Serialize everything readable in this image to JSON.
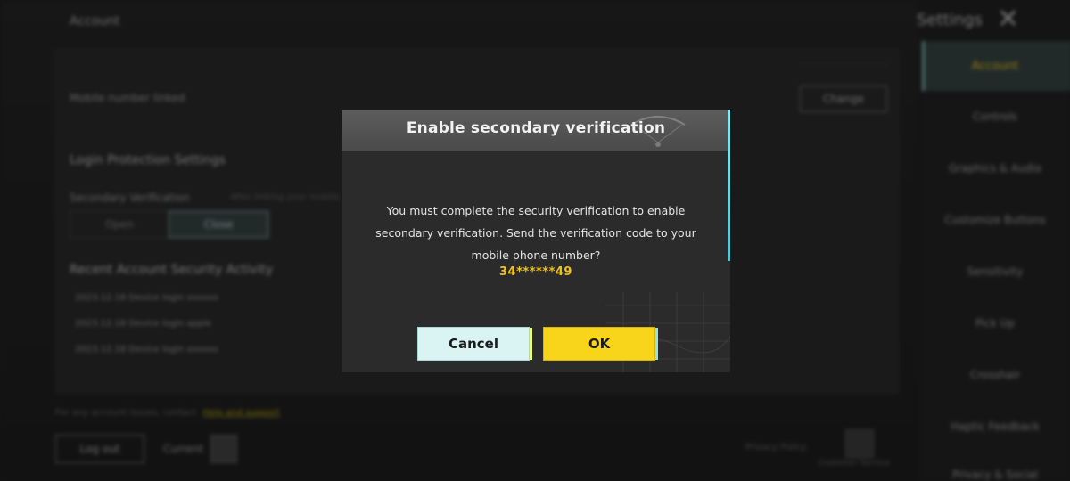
{
  "background": {
    "page_title": "Account",
    "settings_title": "Settings",
    "close_icon": "close-icon",
    "mobile_label": "Mobile number linked",
    "change_label": "Change",
    "login_protection_heading": "Login Protection Settings",
    "secondary_verification_label": "Secondary Verification",
    "secondary_verification_hint": "After linking your mobile...",
    "toggle_options": [
      "Open",
      "Close"
    ],
    "recent_activity_heading": "Recent Account Security Activity",
    "activity_rows": [
      "2023.12.18   Device login   xxxxxx",
      "2023.12.18   Device login   apple",
      "2023.12.18   Device login   xxxxxx"
    ],
    "footer_hint_prefix": "For any account issues, contact",
    "footer_hint_link": "Help and support",
    "log_out_label": "Log out",
    "current_label": "Current",
    "bottom_right_labels": [
      "Privacy Policy",
      "Customer Service"
    ],
    "sidebar_items": [
      "Account",
      "Controls",
      "Graphics & Audio",
      "Customize Buttons",
      "Sensitivity",
      "Pick Up",
      "Crosshair",
      "Haptic Feedback",
      "Privacy & Social"
    ],
    "sidebar_active": "Account"
  },
  "dialog": {
    "title": "Enable secondary verification",
    "message": "You must complete the security verification to enable secondary verification. Send the verification code to your mobile phone number?",
    "phone": "34******49",
    "cancel_label": "Cancel",
    "ok_label": "OK",
    "colors": {
      "accent_yellow": "#f8d51a",
      "cancel_bg": "#d9f4f3",
      "phone_color": "#f0c21e"
    }
  }
}
